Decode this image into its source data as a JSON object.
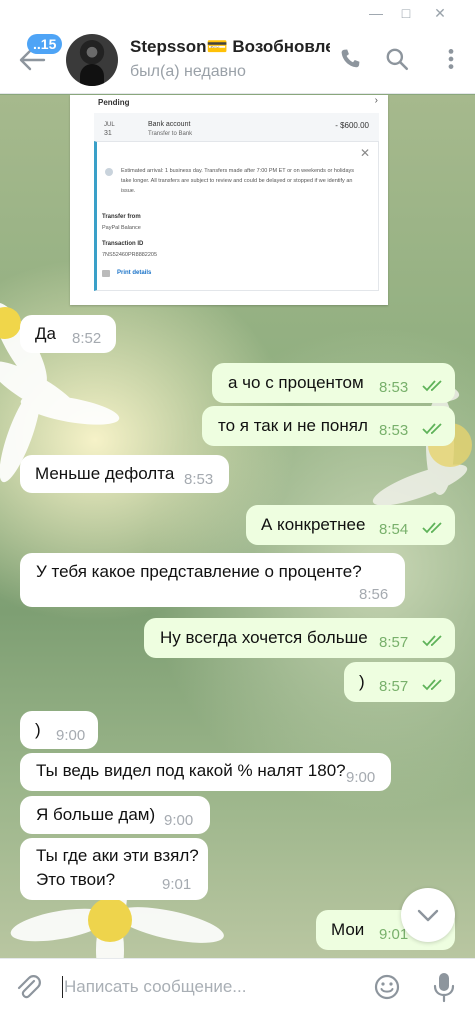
{
  "window": {
    "minimize_glyph": "—",
    "maximize_glyph": "□",
    "close_glyph": "✕"
  },
  "header": {
    "back_badge": "..15",
    "name": "Stepsson💳 Возобновлен",
    "status": "был(а) недавно",
    "icons": [
      "back-arrow-icon",
      "phone-icon",
      "search-icon",
      "more-vertical-icon"
    ]
  },
  "screenshot": {
    "pending": "Pending",
    "date_month": "JUL",
    "date_day": "31",
    "bank": "Bank account",
    "bank_sub": "Transfer to Bank",
    "amount": "- $600.00",
    "estimate": "Estimated arrival: 1 business day. Transfers made after 7:00 PM ET or on weekends or holidays take longer. All transfers are subject to review and could be delayed or stopped if we identify an issue.",
    "transfer_from_label": "Transfer from",
    "transfer_from_value": "PayPal Balance",
    "transaction_id_label": "Transaction ID",
    "transaction_id_value": "7NS52460PR8882205",
    "print": "Print details"
  },
  "messages": [
    {
      "dir": "in",
      "text": "Да",
      "time": "8:52"
    },
    {
      "dir": "out",
      "text": "а чо с процентом",
      "time": "8:53",
      "status": "read"
    },
    {
      "dir": "out",
      "text": "то я так и не понял",
      "time": "8:53",
      "status": "read"
    },
    {
      "dir": "in",
      "text": "Меньше дефолта",
      "time": "8:53"
    },
    {
      "dir": "out",
      "text": "А конкретнее",
      "time": "8:54",
      "status": "read"
    },
    {
      "dir": "in",
      "text": "У тебя какое представление о проценте?",
      "time": "8:56"
    },
    {
      "dir": "out",
      "text": "Ну всегда хочется больше",
      "time": "8:57",
      "status": "read"
    },
    {
      "dir": "out",
      "text": ")",
      "time": "8:57",
      "status": "read"
    },
    {
      "dir": "in",
      "text": ")",
      "time": "9:00"
    },
    {
      "dir": "in",
      "text": "Ты ведь видел под какой % налят 180?",
      "time": "9:00"
    },
    {
      "dir": "in",
      "text": "Я больше дам)",
      "time": "9:00"
    },
    {
      "dir": "in",
      "text": "Ты где аки эти взял?",
      "text2": "Это твои?",
      "time": "9:01"
    },
    {
      "dir": "out",
      "text": "Мои",
      "time": "9:01",
      "status": "read"
    }
  ],
  "composer": {
    "placeholder": "Написать сообщение...",
    "icons": [
      "attach-icon",
      "emoji-icon",
      "mic-icon"
    ]
  },
  "colors": {
    "incoming_bubble": "#ffffff",
    "outgoing_bubble": "#eefee0",
    "read_ticks": "#5fb35a",
    "badge": "#4ea4f6"
  }
}
